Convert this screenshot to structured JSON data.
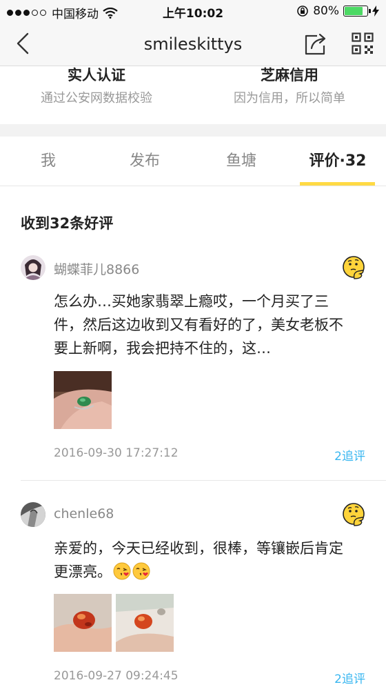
{
  "status_bar": {
    "carrier": "中国移动",
    "time": "上午10:02",
    "battery": "80%",
    "battery_level": 0.8
  },
  "nav": {
    "title": "smileskittys",
    "icons": [
      "back-chevron-icon",
      "share-icon",
      "qr-code-icon"
    ]
  },
  "verify": {
    "real_name": {
      "title": "实人认证",
      "subtitle": "通过公安网数据校验"
    },
    "sesame": {
      "title": "芝麻信用",
      "subtitle": "因为信用，所以简单"
    }
  },
  "tabs": [
    {
      "label": "我",
      "active": false
    },
    {
      "label": "发布",
      "active": false
    },
    {
      "label": "鱼塘",
      "active": false
    },
    {
      "label": "评价·32",
      "active": true
    }
  ],
  "colors": {
    "accent": "#ffda44",
    "link": "#38b6f0",
    "battery": "#4cd964"
  },
  "reviews": {
    "summary": "收到32条好评",
    "items": [
      {
        "username": "蝴蝶菲儿8866",
        "text": "怎么办…买她家翡翠上瘾哎，一个月买了三件，然后这边收到又有看好的了，美女老板不要上新啊，我会把持不住的，这…",
        "date": "2016-09-30 17:27:12",
        "followups": "2追评",
        "images": [
          "jade-ring-photo"
        ],
        "badge_icon": "thinking-emoji-icon"
      },
      {
        "username": "chenle68",
        "text": "亲爱的，今天已经收到，很棒，等镶嵌后肯定更漂亮。",
        "date": "2016-09-27 09:24:45",
        "followups": "2追评",
        "images": [
          "amber-stone-photo",
          "amber-stone-photo"
        ],
        "badge_icon": "thinking-emoji-icon",
        "inline_icons": [
          "kiss-emoji-icon",
          "kiss-emoji-icon"
        ]
      }
    ]
  }
}
